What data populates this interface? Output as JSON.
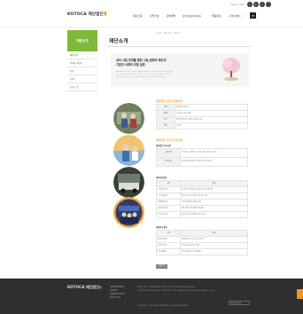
{
  "header": {
    "logo_text": "KOTOCA 재단법인",
    "utility_links": [
      "LOGIN",
      "JOIN"
    ],
    "sns_icons": [
      "facebook-icon",
      "blog-icon",
      "twitter-icon",
      "instagram-icon"
    ],
    "menu": [
      "재단소개",
      "사업안내",
      "참여방법",
      "제주자원활동지원센터",
      "알림마당",
      "관련사이트"
    ]
  },
  "sidebar": {
    "title": "재단소개",
    "items": [
      {
        "label": "재단소개",
        "active": true
      },
      {
        "label": "이사장 인사말",
        "active": false
      },
      {
        "label": "연혁",
        "active": false
      },
      {
        "label": "조직도",
        "active": false
      },
      {
        "label": "오시는 길",
        "active": false
      }
    ]
  },
  "main": {
    "breadcrumb": "HOME > 재단소개 > 재단소개",
    "title": "재단소개",
    "intro": {
      "heading_line1": "공익 사업 전개를 통한 나눔 문화의 확산과",
      "heading_line2": "기업과 사회의 모범 실현",
      "body_lines": [
        "재단법인 코토카는 나눔의 가치를 실천하기 위하여 설립된 공익재단입니다.",
        "지역사회 발전과 소외계층 지원을 위한 다양한 사업을 추진하고 있습니다.",
        "앞으로도 더불어 사는 사회를 만들기 위해 최선을 다하겠습니다."
      ]
    },
    "section1": {
      "title": "재단법인 코토카 설립목적",
      "rows": [
        {
          "label": "명칭",
          "value": "재단법인 코토카"
        },
        {
          "label": "설립일",
          "value": "2012년 06월 설립"
        },
        {
          "label": "주소",
          "value": "제주특별자치도 제주시 첨단로 242"
        },
        {
          "label": "대표",
          "value": "이사장"
        }
      ]
    },
    "section2": {
      "title": "재단법인 코토카 주요사업",
      "sub_title": "재단법인 주요사업",
      "table_a": [
        {
          "head": "나눔사업",
          "desc": "지역사회 소외계층 지원 및 나눔 문화 확산 사업"
        },
        {
          "head": "장학사업",
          "desc": "지역 인재 육성을 위한 장학금 지원 사업"
        }
      ],
      "sub_title_b": "세부추진사업",
      "table_b_header": [
        "구분",
        "내용"
      ],
      "table_b": [
        [
          "사회공헌사업",
          "지역사회 공헌 활동 및 봉사 프로그램 운영"
        ],
        [
          "교육지원사업",
          "청소년 교육 및 진로 지원 프로그램"
        ],
        [
          "문화예술사업",
          "지역 문화예술 활성화 지원"
        ],
        [
          "환경보전사업",
          "제주 환경 보전 캠페인 및 활동"
        ],
        [
          "복지지원사업",
          "저소득층 및 취약계층 복지 지원"
        ]
      ],
      "sub_title_c": "자원봉사 활동",
      "table_c_header": [
        "구분",
        "내용"
      ],
      "table_c": [
        [
          "자원봉사센터",
          "자원봉사자 모집 및 교육 운영"
        ],
        [
          "봉사단 운영",
          "임직원 봉사단 정기 활동"
        ],
        [
          "나눔 캠페인",
          "연말 이웃돕기 나눔 캠페인"
        ]
      ],
      "button_label": "더보기"
    }
  },
  "footer": {
    "logo_text": "KOTOCA 재단법인",
    "links": [
      "개인정보처리방침",
      "이용약관",
      "이메일무단수집거부",
      "찾아오시는 길"
    ],
    "info_lines": [
      "재단법인 코토카 | 제주특별자치도 제주시 첨단로 242 | 대표전화 064-000-0000",
      "사업자등록번호 000-00-00000 | 대표자 이사장 | 팩스 064-000-0000 | E-mail: kotoca@kotoca.or.kr",
      "COPYRIGHT © KOTOCA FOUNDATION. ALL RIGHTS RESERVED."
    ],
    "family_site": "Family Site"
  },
  "colors": {
    "accent_green": "#7dba3a",
    "accent_orange": "#f7941d",
    "footer_bg": "#2f2f2f"
  }
}
